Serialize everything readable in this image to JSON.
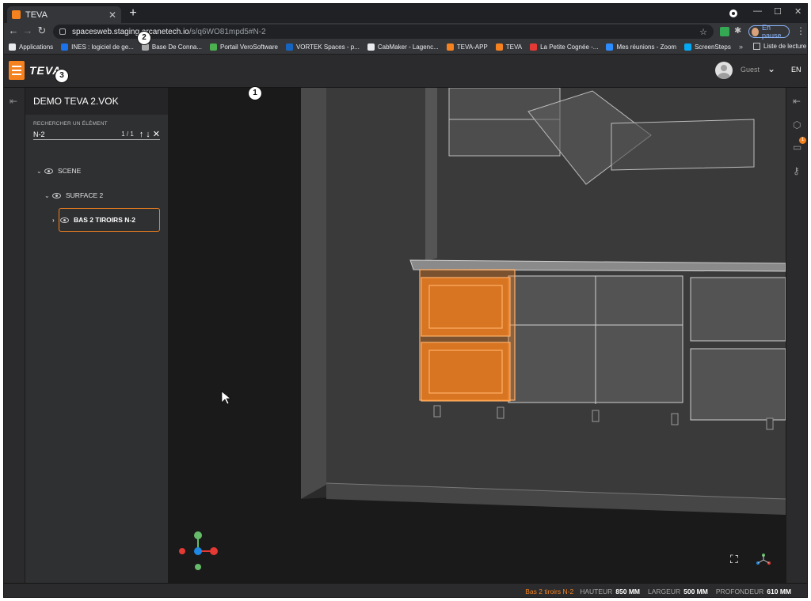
{
  "browser": {
    "tab_title": "TEVA",
    "url_host": "spacesweb.staging.arcanetech.io",
    "url_path": "/s/q6WO81mpd5#N-2",
    "profile_label": "En pause",
    "bookmarks": [
      {
        "label": "Applications",
        "color": "#e8eaed"
      },
      {
        "label": "INES : logiciel de ge...",
        "color": "#1a73e8"
      },
      {
        "label": "Base De Conna...",
        "color": "#aaaaaa"
      },
      {
        "label": "Portail VeroSoftware",
        "color": "#4caf50"
      },
      {
        "label": "VORTEK Spaces - p...",
        "color": "#1565c0"
      },
      {
        "label": "CabMaker - Lagenc...",
        "color": "#e8eaed"
      },
      {
        "label": "TEVA-APP",
        "color": "#f5821f"
      },
      {
        "label": "TEVA",
        "color": "#f5821f"
      },
      {
        "label": "La Petite Cognée -...",
        "color": "#e53935"
      },
      {
        "label": "Mes réunions - Zoom",
        "color": "#2d8cff"
      },
      {
        "label": "ScreenSteps",
        "color": "#03a9f4"
      }
    ],
    "reading_list": "Liste de lecture"
  },
  "app": {
    "brand": "TEVA",
    "user_name": "Guest",
    "language": "EN",
    "project_title": "DEMO TEVA 2.VOK",
    "search": {
      "label": "RECHERCHER UN ÉLÉMENT",
      "value": "N-2",
      "count": "1 / 1"
    },
    "tree": [
      {
        "label": "SCENE"
      },
      {
        "label": "SURFACE 2"
      },
      {
        "label": "BAS 2 TIROIRS N-2"
      }
    ],
    "notification_count": "1"
  },
  "status": {
    "selection": "Bas 2 tiroirs N-2",
    "height_label": "HAUTEUR",
    "height_value": "850 MM",
    "width_label": "LARGEUR",
    "width_value": "500 MM",
    "depth_label": "PROFONDEUR",
    "depth_value": "610 MM"
  },
  "markers": [
    "1",
    "2",
    "3"
  ],
  "colors": {
    "accent": "#f5821f",
    "viewport_bg": "#191919",
    "panel_bg": "#2f3032"
  }
}
